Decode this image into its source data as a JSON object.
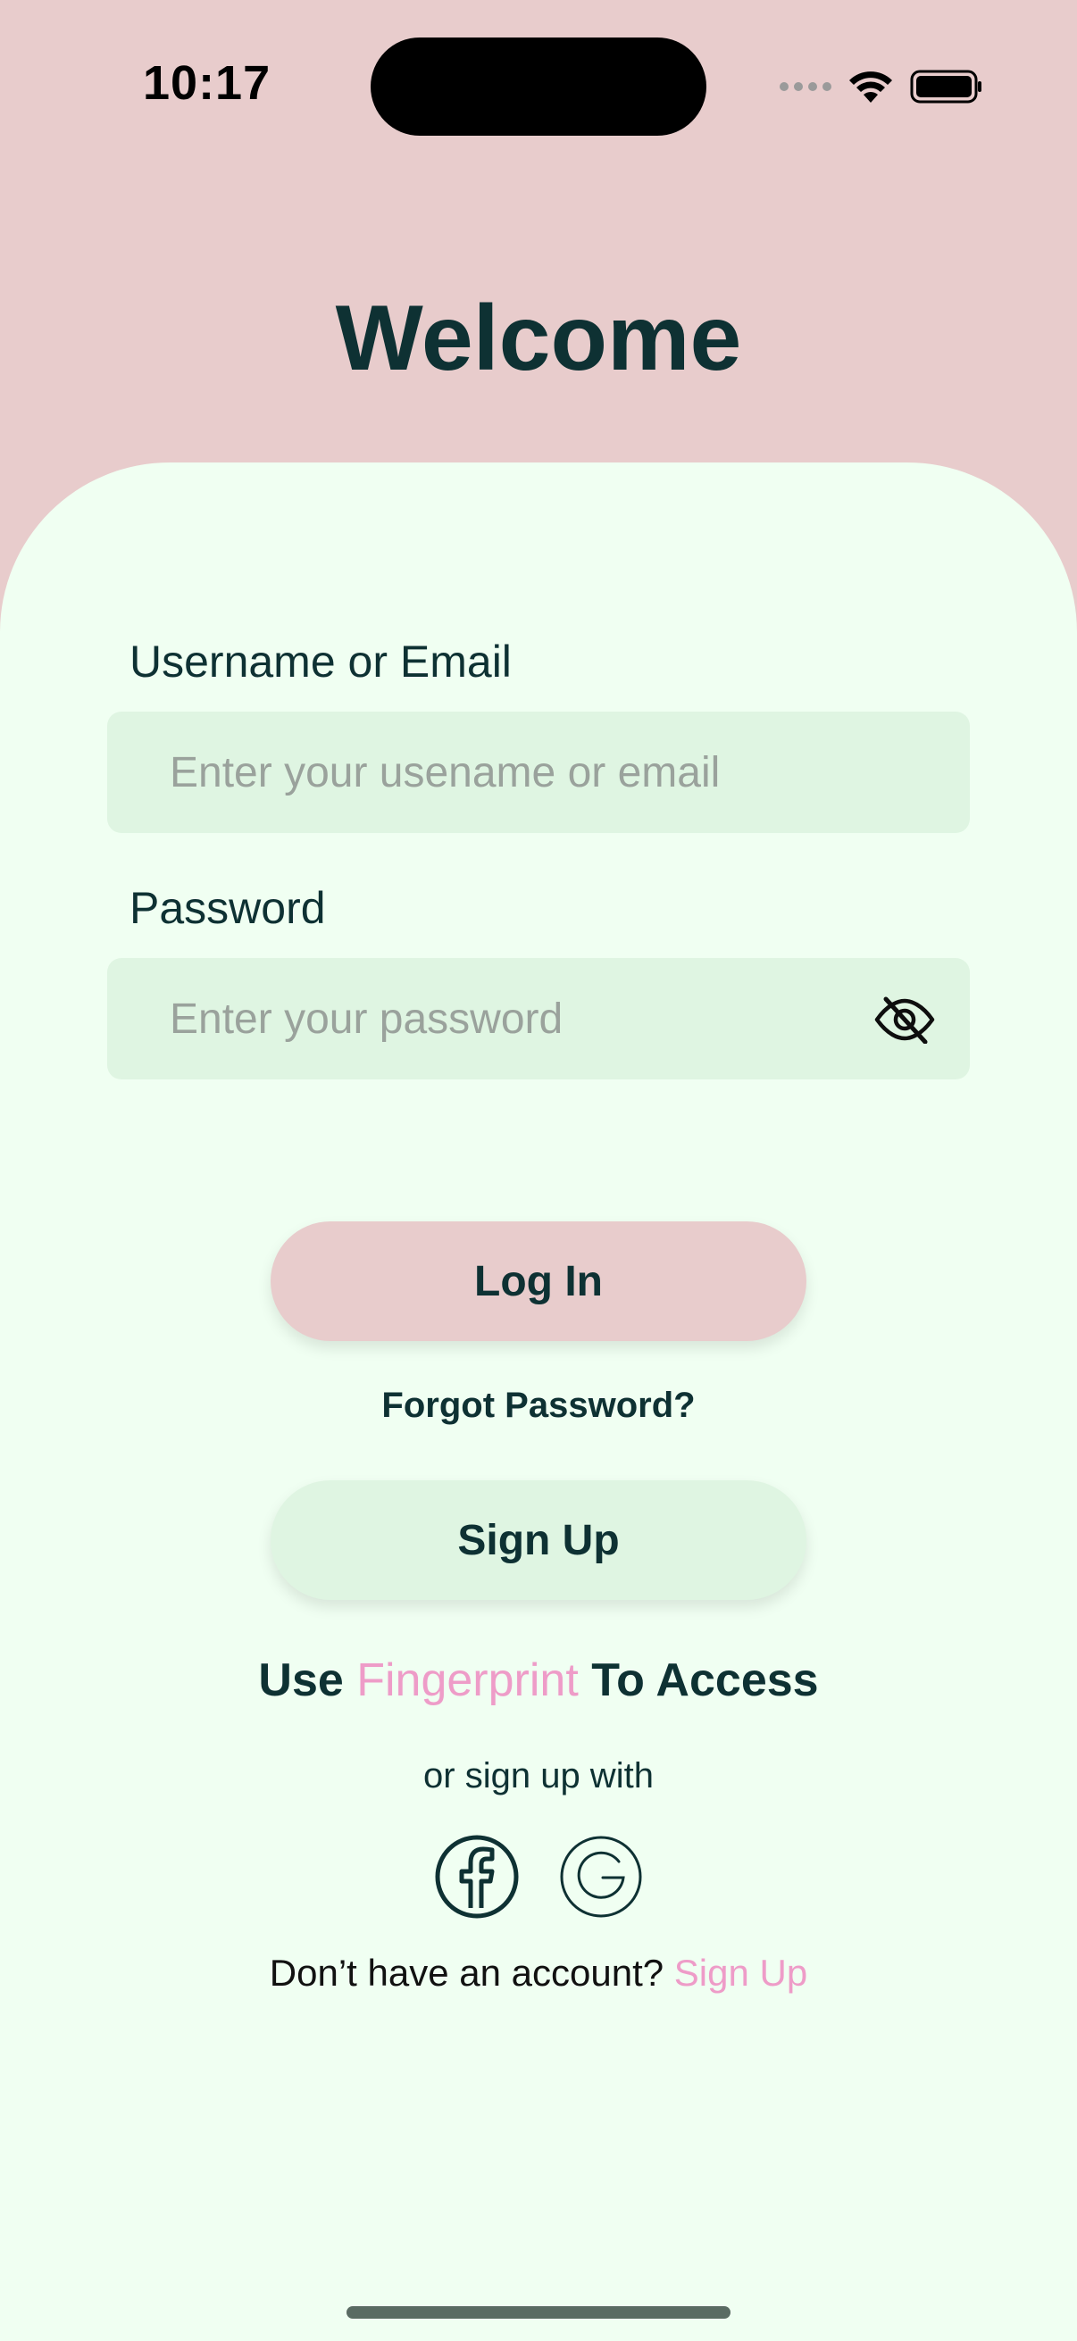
{
  "status_bar": {
    "time": "10:17",
    "icons": [
      "cellular-signal-icon",
      "wifi-icon",
      "battery-icon"
    ]
  },
  "header": {
    "title": "Welcome"
  },
  "form": {
    "username_label": "Username or Email",
    "username_placeholder": "Enter your usename or email",
    "username_value": "",
    "password_label": "Password",
    "password_placeholder": "Enter your password",
    "password_value": "",
    "password_toggle_icon": "eye-off-icon"
  },
  "actions": {
    "login_label": "Log In",
    "forgot_label": "Forgot Password?",
    "signup_label": "Sign Up"
  },
  "fingerprint": {
    "prefix": "Use ",
    "accent": "Fingerprint",
    "suffix": " To Access"
  },
  "social": {
    "or_text": "or sign up with",
    "providers": [
      "facebook-icon",
      "google-icon"
    ]
  },
  "footer": {
    "prompt": "Don’t have an account? ",
    "link": "Sign Up"
  },
  "colors": {
    "background_top": "#e8cccc",
    "card": "#f0fff2",
    "input": "#dff5e2",
    "text_dark": "#0e3133",
    "accent_pink": "#ee9cc8"
  }
}
